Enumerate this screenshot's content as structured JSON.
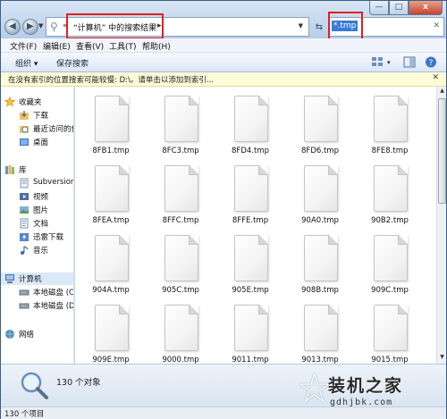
{
  "address": {
    "breadcrumb": "“计算机” 中的搜索结果",
    "search_value": "*.tmp"
  },
  "window_controls": {
    "minimize": "—",
    "maximize": "□",
    "close": "x"
  },
  "menu": [
    "文件(F)",
    "编辑(E)",
    "查看(V)",
    "工具(T)",
    "帮助(H)"
  ],
  "commands": {
    "organize": "组织",
    "save_search": "保存搜索"
  },
  "info_bar": {
    "text": "在没有索引的位置搜索可能较慢: D:\\。请单击以添加到索引..."
  },
  "nav": {
    "favorites": {
      "label": "收藏夹",
      "items": [
        "下载",
        "最近访问的位置",
        "桌面"
      ]
    },
    "libraries": {
      "label": "库",
      "items": [
        "Subversion",
        "视频",
        "图片",
        "文档",
        "迅雷下载",
        "音乐"
      ]
    },
    "computer": {
      "label": "计算机",
      "items": [
        "本地磁盘 (C:)",
        "本地磁盘 (D:)"
      ]
    },
    "network": {
      "label": "网络"
    }
  },
  "files": [
    "8FB1.tmp",
    "8FC3.tmp",
    "8FD4.tmp",
    "8FD6.tmp",
    "8FE8.tmp",
    "8FEA.tmp",
    "8FFC.tmp",
    "8FFE.tmp",
    "90A0.tmp",
    "90B2.tmp",
    "904A.tmp",
    "905C.tmp",
    "905E.tmp",
    "908B.tmp",
    "909C.tmp",
    "909E.tmp",
    "9000.tmp",
    "9011.tmp",
    "9013.tmp",
    "9015.tmp"
  ],
  "details": {
    "count": "130 个对象"
  },
  "status": {
    "text": "130 个项目"
  },
  "watermark": {
    "name": "装机之家",
    "url": "gdhjbk.com"
  },
  "colors": {
    "highlight_red": "#e02020",
    "selection_blue": "#3a7bd5"
  }
}
